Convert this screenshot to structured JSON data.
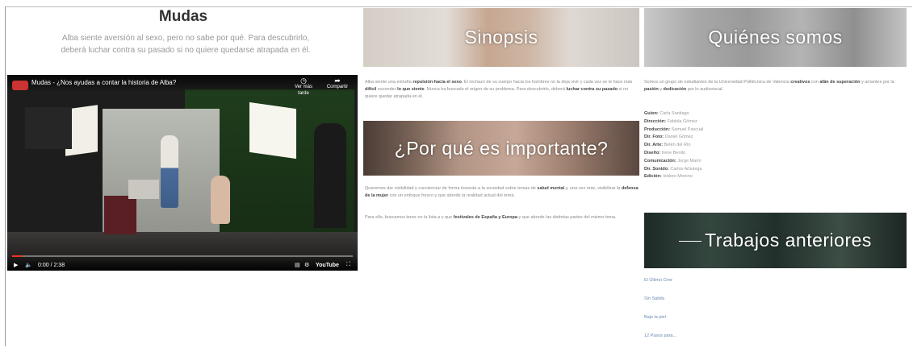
{
  "header": {
    "title": "Mudas",
    "subtitle_line1": "Alba siente aversión al sexo, pero no sabe por qué. Para descubrirlo,",
    "subtitle_line2": "deberá luchar contra su pasado si no quiere quedarse atrapada en él."
  },
  "video": {
    "title": "Mudas - ¿Nos ayudas a contar la historia de Alba?",
    "watch_later_label": "Ver más tarde",
    "share_label": "Compartir",
    "time": "0:00 / 2:38",
    "progress": 0.03,
    "brand": "YouTube",
    "icons": {
      "play": "play-icon",
      "volume": "volume-icon",
      "watch_later": "clock-icon",
      "share": "share-icon",
      "subtitles": "subtitles-icon",
      "settings": "gear-icon",
      "fullscreen": "fullscreen-icon"
    }
  },
  "banners": {
    "sinopsis": "Sinopsis",
    "importante": "¿Por qué es importante?",
    "quienes": "Quiénes somos",
    "trabajos": "Trabajos anteriores"
  },
  "sinopsis": {
    "text_a": "Alba siente una extraña",
    "bold_a": "repulsión hacia el sexo",
    "text_b": ". El rechazo de su cuerpo hacia los hombres no la deja vivir y cada vez se le hace más",
    "bold_b": "difícil",
    "text_c": "esconder",
    "bold_c": "lo que siente",
    "text_d": ". Nunca ha buscado el origen de su problema. Para descubrirlo, deberá",
    "bold_d": "luchar contra su pasado",
    "text_e": "si no quiere quedar atrapada en él."
  },
  "importante": {
    "p1_text_a": "Queremos dar visibilidad y concienciar de forma honesta a la sociedad sobre temas de",
    "p1_bold_a": "salud mental",
    "p1_text_b": "y, una vez más, visibilizar la",
    "p1_bold_b": "defensa de la mujer",
    "p1_text_c": "con un enfoque fresco y que aborde la realidad actual del tema.",
    "p2_text_a": "Para ello, buscamos tener en la lista a y que",
    "p2_bold_a": "festivales de España y Europa",
    "p2_text_b": "y que aborde las distintas partes del mismo tema."
  },
  "quienes": {
    "intro_a": "Somos un grupo de estudiantes de la Universidad Politécnica de Valencia",
    "intro_bold_a": "creativos",
    "intro_b": "con",
    "intro_bold_b": "afán de superación",
    "intro_c": "y amantes por la",
    "intro_bold_c": "pasión",
    "intro_d": "y",
    "intro_bold_d": "dedicación",
    "intro_e": "por lo audiovisual.",
    "credits": [
      {
        "role": "Guion:",
        "name": "Carla Santiago"
      },
      {
        "role": "Dirección:",
        "name": "Fabiola Gómez"
      },
      {
        "role": "Producción:",
        "name": "Samuel Pascual"
      },
      {
        "role": "Dir. Foto:",
        "name": "Daniel Gómez"
      },
      {
        "role": "Dir. Arte:",
        "name": "Belén del Río"
      },
      {
        "role": "Diseño:",
        "name": "Irene Benito"
      },
      {
        "role": "Comunicación:",
        "name": "Jorge Marín"
      },
      {
        "role": "Dir. Sonido:",
        "name": "Carlos Arbulega"
      },
      {
        "role": "Edición:",
        "name": "Isidoro Moreno"
      }
    ]
  },
  "trabajos": {
    "links": [
      "El Último Cine",
      "Sin Salida",
      "Bajo la piel",
      "12 Pasos para..."
    ]
  }
}
